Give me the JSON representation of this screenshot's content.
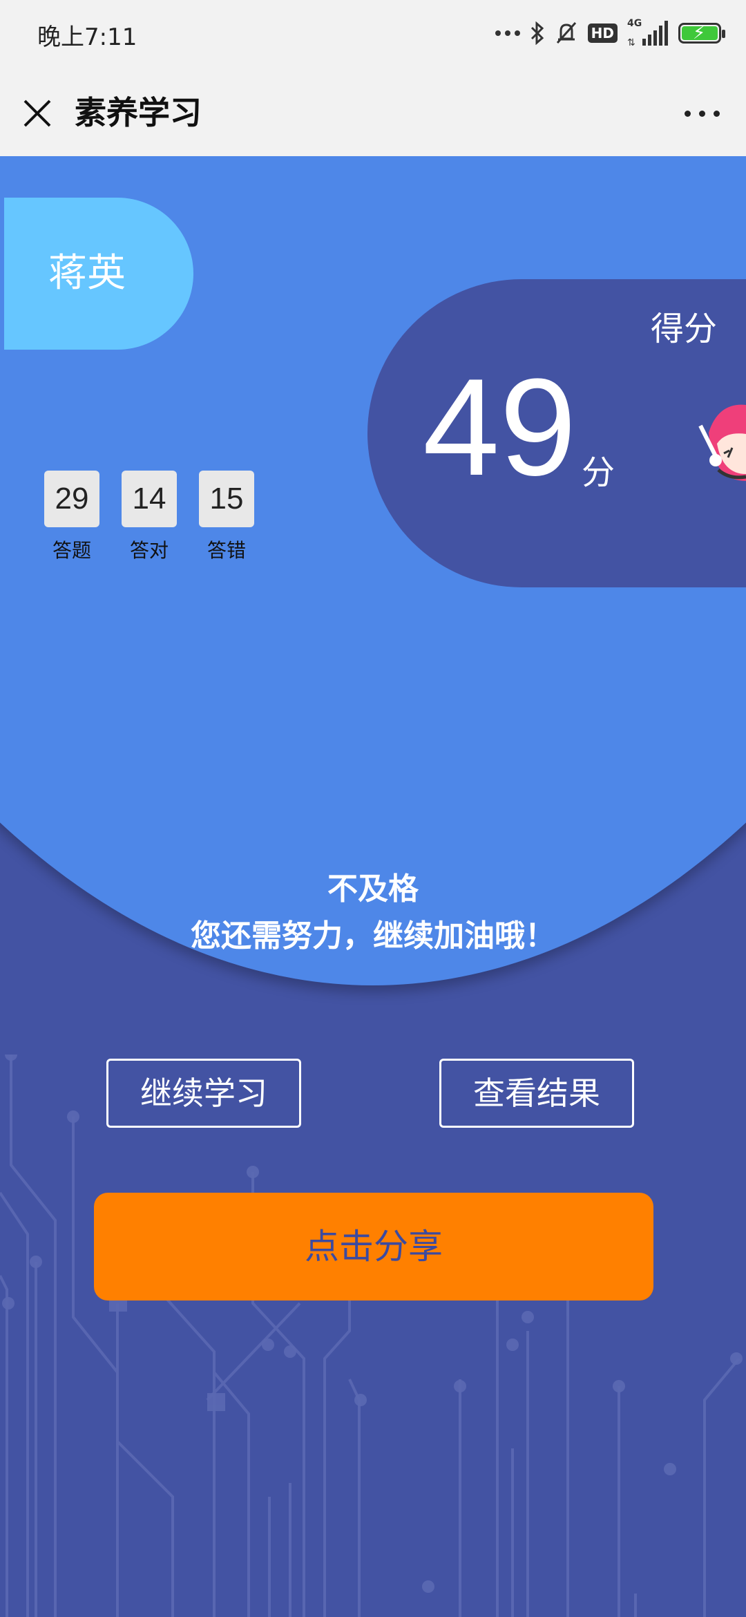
{
  "status_bar": {
    "time": "晚上7:11",
    "network": "4G"
  },
  "header": {
    "title": "素养学习"
  },
  "user": {
    "name": "蒋英"
  },
  "score": {
    "label": "得分",
    "value": "49",
    "unit": "分"
  },
  "stats": [
    {
      "value": "29",
      "label": "答题"
    },
    {
      "value": "14",
      "label": "答对"
    },
    {
      "value": "15",
      "label": "答错"
    }
  ],
  "result": {
    "status": "不及格",
    "message": "您还需努力，继续加油哦！"
  },
  "buttons": {
    "continue": "继续学习",
    "view_result": "查看结果",
    "share": "点击分享"
  },
  "colors": {
    "primary_blue": "#4e87e8",
    "dark_blue": "#4353a3",
    "light_blue": "#66c6ff",
    "orange": "#ff8000"
  }
}
